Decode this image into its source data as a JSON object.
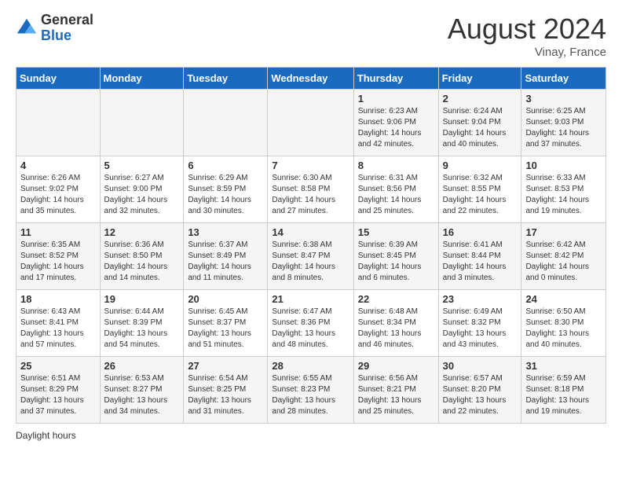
{
  "header": {
    "logo_general": "General",
    "logo_blue": "Blue",
    "month_year": "August 2024",
    "location": "Vinay, France"
  },
  "days_of_week": [
    "Sunday",
    "Monday",
    "Tuesday",
    "Wednesday",
    "Thursday",
    "Friday",
    "Saturday"
  ],
  "weeks": [
    [
      {
        "num": "",
        "info": ""
      },
      {
        "num": "",
        "info": ""
      },
      {
        "num": "",
        "info": ""
      },
      {
        "num": "",
        "info": ""
      },
      {
        "num": "1",
        "info": "Sunrise: 6:23 AM\nSunset: 9:06 PM\nDaylight: 14 hours and 42 minutes."
      },
      {
        "num": "2",
        "info": "Sunrise: 6:24 AM\nSunset: 9:04 PM\nDaylight: 14 hours and 40 minutes."
      },
      {
        "num": "3",
        "info": "Sunrise: 6:25 AM\nSunset: 9:03 PM\nDaylight: 14 hours and 37 minutes."
      }
    ],
    [
      {
        "num": "4",
        "info": "Sunrise: 6:26 AM\nSunset: 9:02 PM\nDaylight: 14 hours and 35 minutes."
      },
      {
        "num": "5",
        "info": "Sunrise: 6:27 AM\nSunset: 9:00 PM\nDaylight: 14 hours and 32 minutes."
      },
      {
        "num": "6",
        "info": "Sunrise: 6:29 AM\nSunset: 8:59 PM\nDaylight: 14 hours and 30 minutes."
      },
      {
        "num": "7",
        "info": "Sunrise: 6:30 AM\nSunset: 8:58 PM\nDaylight: 14 hours and 27 minutes."
      },
      {
        "num": "8",
        "info": "Sunrise: 6:31 AM\nSunset: 8:56 PM\nDaylight: 14 hours and 25 minutes."
      },
      {
        "num": "9",
        "info": "Sunrise: 6:32 AM\nSunset: 8:55 PM\nDaylight: 14 hours and 22 minutes."
      },
      {
        "num": "10",
        "info": "Sunrise: 6:33 AM\nSunset: 8:53 PM\nDaylight: 14 hours and 19 minutes."
      }
    ],
    [
      {
        "num": "11",
        "info": "Sunrise: 6:35 AM\nSunset: 8:52 PM\nDaylight: 14 hours and 17 minutes."
      },
      {
        "num": "12",
        "info": "Sunrise: 6:36 AM\nSunset: 8:50 PM\nDaylight: 14 hours and 14 minutes."
      },
      {
        "num": "13",
        "info": "Sunrise: 6:37 AM\nSunset: 8:49 PM\nDaylight: 14 hours and 11 minutes."
      },
      {
        "num": "14",
        "info": "Sunrise: 6:38 AM\nSunset: 8:47 PM\nDaylight: 14 hours and 8 minutes."
      },
      {
        "num": "15",
        "info": "Sunrise: 6:39 AM\nSunset: 8:45 PM\nDaylight: 14 hours and 6 minutes."
      },
      {
        "num": "16",
        "info": "Sunrise: 6:41 AM\nSunset: 8:44 PM\nDaylight: 14 hours and 3 minutes."
      },
      {
        "num": "17",
        "info": "Sunrise: 6:42 AM\nSunset: 8:42 PM\nDaylight: 14 hours and 0 minutes."
      }
    ],
    [
      {
        "num": "18",
        "info": "Sunrise: 6:43 AM\nSunset: 8:41 PM\nDaylight: 13 hours and 57 minutes."
      },
      {
        "num": "19",
        "info": "Sunrise: 6:44 AM\nSunset: 8:39 PM\nDaylight: 13 hours and 54 minutes."
      },
      {
        "num": "20",
        "info": "Sunrise: 6:45 AM\nSunset: 8:37 PM\nDaylight: 13 hours and 51 minutes."
      },
      {
        "num": "21",
        "info": "Sunrise: 6:47 AM\nSunset: 8:36 PM\nDaylight: 13 hours and 48 minutes."
      },
      {
        "num": "22",
        "info": "Sunrise: 6:48 AM\nSunset: 8:34 PM\nDaylight: 13 hours and 46 minutes."
      },
      {
        "num": "23",
        "info": "Sunrise: 6:49 AM\nSunset: 8:32 PM\nDaylight: 13 hours and 43 minutes."
      },
      {
        "num": "24",
        "info": "Sunrise: 6:50 AM\nSunset: 8:30 PM\nDaylight: 13 hours and 40 minutes."
      }
    ],
    [
      {
        "num": "25",
        "info": "Sunrise: 6:51 AM\nSunset: 8:29 PM\nDaylight: 13 hours and 37 minutes."
      },
      {
        "num": "26",
        "info": "Sunrise: 6:53 AM\nSunset: 8:27 PM\nDaylight: 13 hours and 34 minutes."
      },
      {
        "num": "27",
        "info": "Sunrise: 6:54 AM\nSunset: 8:25 PM\nDaylight: 13 hours and 31 minutes."
      },
      {
        "num": "28",
        "info": "Sunrise: 6:55 AM\nSunset: 8:23 PM\nDaylight: 13 hours and 28 minutes."
      },
      {
        "num": "29",
        "info": "Sunrise: 6:56 AM\nSunset: 8:21 PM\nDaylight: 13 hours and 25 minutes."
      },
      {
        "num": "30",
        "info": "Sunrise: 6:57 AM\nSunset: 8:20 PM\nDaylight: 13 hours and 22 minutes."
      },
      {
        "num": "31",
        "info": "Sunrise: 6:59 AM\nSunset: 8:18 PM\nDaylight: 13 hours and 19 minutes."
      }
    ]
  ],
  "footer": {
    "label": "Daylight hours"
  }
}
